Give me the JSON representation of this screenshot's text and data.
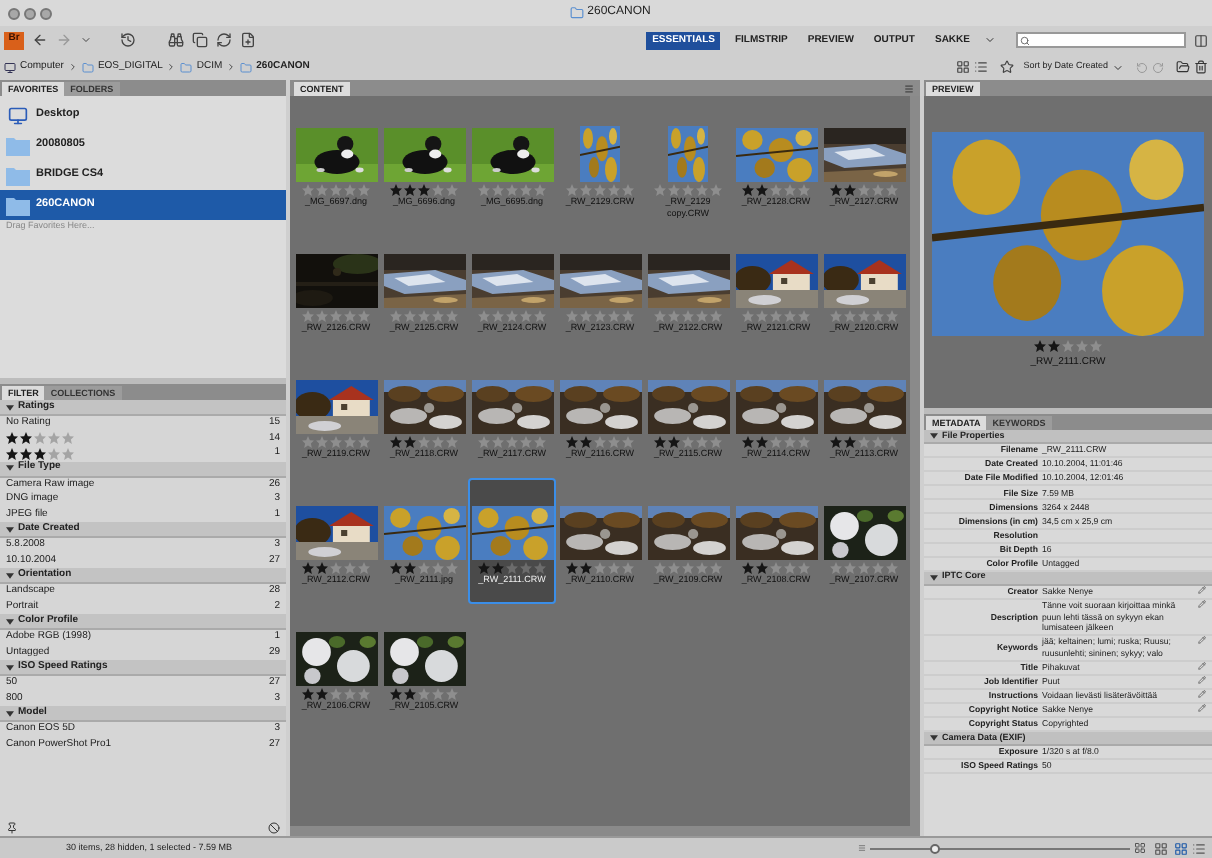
{
  "window": {
    "title": "260CANON"
  },
  "toolbar": {
    "app_badge": "Br",
    "workspaces": [
      {
        "label": "ESSENTIALS",
        "selected": true
      },
      {
        "label": "FILMSTRIP",
        "selected": false
      },
      {
        "label": "PREVIEW",
        "selected": false
      },
      {
        "label": "OUTPUT",
        "selected": false
      },
      {
        "label": "SAKKE",
        "selected": false
      }
    ]
  },
  "path": [
    "Computer",
    "EOS_DIGITAL",
    "DCIM",
    "260CANON"
  ],
  "sort": "Sort by Date Created",
  "favorites": {
    "tabs": [
      {
        "label": "FAVORITES",
        "selected": true
      },
      {
        "label": "FOLDERS",
        "selected": false
      }
    ],
    "items": [
      {
        "label": "Desktop",
        "kind": "desktop",
        "selected": false
      },
      {
        "label": "20080805",
        "kind": "folder",
        "selected": false
      },
      {
        "label": "BRIDGE CS4",
        "kind": "folder",
        "selected": false
      },
      {
        "label": "260CANON",
        "kind": "folder",
        "selected": true
      }
    ],
    "hint": "Drag Favorites Here..."
  },
  "filter": {
    "tabs": [
      {
        "label": "FILTER",
        "selected": true
      },
      {
        "label": "COLLECTIONS",
        "selected": false
      }
    ],
    "groups": [
      {
        "title": "Ratings",
        "expanded": true,
        "items": [
          {
            "label": "No Rating",
            "count": "15"
          },
          {
            "stars": 2,
            "count": "14"
          },
          {
            "stars": 3,
            "count": "1"
          }
        ]
      },
      {
        "title": "File Type",
        "expanded": true,
        "items": [
          {
            "label": "Camera Raw image",
            "count": "26"
          },
          {
            "label": "DNG image",
            "count": "3"
          },
          {
            "label": "JPEG file",
            "count": "1"
          }
        ]
      },
      {
        "title": "Date Created",
        "expanded": true,
        "items": [
          {
            "label": "5.8.2008",
            "count": "3"
          },
          {
            "label": "10.10.2004",
            "count": "27"
          }
        ]
      },
      {
        "title": "Orientation",
        "expanded": true,
        "items": [
          {
            "label": "Landscape",
            "count": "28"
          },
          {
            "label": "Portrait",
            "count": "2"
          }
        ]
      },
      {
        "title": "Color Profile",
        "expanded": true,
        "items": [
          {
            "label": "Adobe RGB (1998)",
            "count": "1"
          },
          {
            "label": "Untagged",
            "count": "29"
          }
        ]
      },
      {
        "title": "ISO Speed Ratings",
        "expanded": true,
        "items": [
          {
            "label": "50",
            "count": "27"
          },
          {
            "label": "800",
            "count": "3"
          }
        ]
      },
      {
        "title": "Model",
        "expanded": true,
        "items": [
          {
            "label": "Canon EOS 5D",
            "count": "3"
          },
          {
            "label": "Canon PowerShot Pro1",
            "count": "27"
          }
        ]
      }
    ]
  },
  "content": {
    "title": "CONTENT",
    "thumbnails": [
      {
        "filename": "_MG_6697.dng",
        "stars": 0,
        "kind": "landscape",
        "selected": false
      },
      {
        "filename": "_MG_6696.dng",
        "stars": 3,
        "kind": "landscape",
        "selected": false
      },
      {
        "filename": "_MG_6695.dng",
        "stars": 0,
        "kind": "landscape",
        "selected": false
      },
      {
        "filename": "_RW_2129.CRW",
        "stars": 0,
        "kind": "portrait",
        "selected": false
      },
      {
        "filename": "_RW_2129 copy.CRW",
        "stars": 0,
        "kind": "portrait",
        "selected": false
      },
      {
        "filename": "_RW_2128.CRW",
        "stars": 2,
        "kind": "landscape",
        "selected": false
      },
      {
        "filename": "_RW_2127.CRW",
        "stars": 2,
        "kind": "landscape",
        "selected": false
      },
      {
        "filename": "_RW_2126.CRW",
        "stars": 0,
        "kind": "landscape",
        "selected": false
      },
      {
        "filename": "_RW_2125.CRW",
        "stars": 0,
        "kind": "landscape",
        "selected": false
      },
      {
        "filename": "_RW_2124.CRW",
        "stars": 0,
        "kind": "landscape",
        "selected": false
      },
      {
        "filename": "_RW_2123.CRW",
        "stars": 0,
        "kind": "landscape",
        "selected": false
      },
      {
        "filename": "_RW_2122.CRW",
        "stars": 0,
        "kind": "landscape",
        "selected": false
      },
      {
        "filename": "_RW_2121.CRW",
        "stars": 0,
        "kind": "landscape",
        "selected": false
      },
      {
        "filename": "_RW_2120.CRW",
        "stars": 0,
        "kind": "landscape",
        "selected": false
      },
      {
        "filename": "_RW_2119.CRW",
        "stars": 0,
        "kind": "landscape",
        "selected": false
      },
      {
        "filename": "_RW_2118.CRW",
        "stars": 2,
        "kind": "landscape",
        "selected": false
      },
      {
        "filename": "_RW_2117.CRW",
        "stars": 0,
        "kind": "landscape",
        "selected": false
      },
      {
        "filename": "_RW_2116.CRW",
        "stars": 2,
        "kind": "landscape",
        "selected": false
      },
      {
        "filename": "_RW_2115.CRW",
        "stars": 2,
        "kind": "landscape",
        "selected": false
      },
      {
        "filename": "_RW_2114.CRW",
        "stars": 2,
        "kind": "landscape",
        "selected": false
      },
      {
        "filename": "_RW_2113.CRW",
        "stars": 2,
        "kind": "landscape",
        "selected": false
      },
      {
        "filename": "_RW_2112.CRW",
        "stars": 2,
        "kind": "landscape",
        "selected": false
      },
      {
        "filename": "_RW_2111.jpg",
        "stars": 2,
        "kind": "landscape",
        "selected": false
      },
      {
        "filename": "_RW_2111.CRW",
        "stars": 2,
        "kind": "landscape",
        "selected": true
      },
      {
        "filename": "_RW_2110.CRW",
        "stars": 2,
        "kind": "landscape",
        "selected": false
      },
      {
        "filename": "_RW_2109.CRW",
        "stars": 0,
        "kind": "landscape",
        "selected": false
      },
      {
        "filename": "_RW_2108.CRW",
        "stars": 2,
        "kind": "landscape",
        "selected": false
      },
      {
        "filename": "_RW_2107.CRW",
        "stars": 0,
        "kind": "landscape",
        "selected": false
      },
      {
        "filename": "_RW_2106.CRW",
        "stars": 2,
        "kind": "landscape",
        "selected": false
      },
      {
        "filename": "_RW_2105.CRW",
        "stars": 2,
        "kind": "landscape",
        "selected": false
      }
    ]
  },
  "preview": {
    "title": "PREVIEW",
    "caption": "_RW_2111.CRW",
    "stars": 2
  },
  "metadata": {
    "tabs": [
      {
        "label": "METADATA",
        "selected": true
      },
      {
        "label": "KEYWORDS",
        "selected": false
      }
    ],
    "sections": [
      {
        "title": "File Properties",
        "expanded": true,
        "rows": [
          {
            "label": "Filename",
            "value": "_RW_2111.CRW",
            "editable": false
          },
          {
            "label": "Date Created",
            "value": "10.10.2004, 11:01:46",
            "editable": false
          },
          {
            "label": "Date File Modified",
            "value": "10.10.2004, 12:01:46",
            "editable": false
          },
          {
            "label": "File Size",
            "value": "7.59 MB",
            "editable": false
          },
          {
            "label": "Dimensions",
            "value": "3264 x 2448",
            "editable": false
          },
          {
            "label": "Dimensions (in cm)",
            "value": "34,5 cm x 25,9 cm",
            "editable": false
          },
          {
            "label": "Resolution",
            "editable": false
          },
          {
            "label": "Bit Depth",
            "value": "16",
            "editable": false
          },
          {
            "label": "Color Profile",
            "value": "Untagged",
            "editable": false
          }
        ]
      },
      {
        "title": "IPTC Core",
        "expanded": true,
        "rows": [
          {
            "label": "Creator",
            "value": "Sakke Nenye",
            "editable": true
          },
          {
            "label": "Description",
            "value": "Tänne voit suoraan kirjoittaa minkä puun lehti tässä on sykyyn ekan lumisateen jälkeen",
            "editable": true
          },
          {
            "label": "Keywords",
            "value": "jää; keltainen; lumi; ruska; Ruusu; ruusunlehti; sininen; sykyy; valo",
            "editable": true
          },
          {
            "label": "Title",
            "value": "Pihakuvat",
            "editable": true
          },
          {
            "label": "Job Identifier",
            "value": "Puut",
            "editable": true
          },
          {
            "label": "Instructions",
            "value": "Voidaan lievästi lisäterävöittää",
            "editable": true
          },
          {
            "label": "Copyright Notice",
            "value": "Sakke Nenye",
            "editable": true
          },
          {
            "label": "Copyright Status",
            "value": "Copyrighted",
            "editable": false
          }
        ]
      },
      {
        "title": "Camera Data (EXIF)",
        "expanded": true,
        "rows": [
          {
            "label": "Exposure",
            "value": "1/320 s at f/8.0",
            "editable": false
          },
          {
            "label": "ISO Speed Ratings",
            "value": "50",
            "editable": false
          }
        ]
      }
    ]
  },
  "status_bar": {
    "text": "30 items, 28 hidden, 1 selected - 7.59 MB",
    "thumbnail_size": {
      "level": 0.25
    }
  }
}
